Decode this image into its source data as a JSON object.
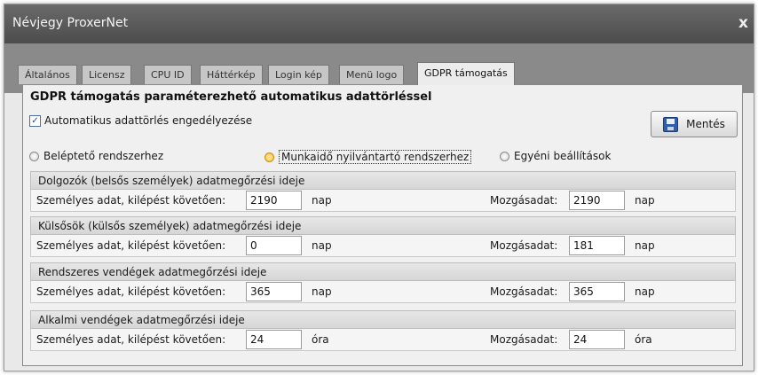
{
  "window": {
    "title": "Névjegy ProxerNet",
    "close_glyph": "x"
  },
  "tabs": [
    "Általános",
    "Licensz",
    "CPU ID",
    "Háttérkép",
    "Login kép",
    "Menü logo",
    "GDPR támogatás"
  ],
  "active_tab_index": 6,
  "panel": {
    "heading": "GDPR támogatás paraméterezhető automatikus adattörléssel",
    "auto_delete": {
      "label": "Automatikus adattörlés engedélyezése",
      "checked": true,
      "mark": "✓"
    },
    "save_label": "Mentés",
    "save_icon": "floppy-disk-icon",
    "modes": [
      {
        "label": "Beléptető rendszerhez",
        "selected": false
      },
      {
        "label": "Munkaidő nyilvántartó rendszerhez",
        "selected": true
      },
      {
        "label": "Egyéni beállítások",
        "selected": false
      }
    ],
    "sections": [
      {
        "title": "Dolgozók (belsős személyek) adatmegőrzési ideje",
        "personal_label": "Személyes adat, kilépést követően:",
        "personal_value": "2190",
        "personal_unit": "nap",
        "movement_label": "Mozgásadat:",
        "movement_value": "2190",
        "movement_unit": "nap"
      },
      {
        "title": "Külsősök (külsős személyek) adatmegőrzési ideje",
        "personal_label": "Személyes adat, kilépést követően:",
        "personal_value": "0",
        "personal_unit": "nap",
        "movement_label": "Mozgásadat:",
        "movement_value": "181",
        "movement_unit": "nap"
      },
      {
        "title": "Rendszeres vendégek adatmegőrzési ideje",
        "personal_label": "Személyes adat, kilépést követően:",
        "personal_value": "365",
        "personal_unit": "nap",
        "movement_label": "Mozgásadat:",
        "movement_value": "365",
        "movement_unit": "nap"
      },
      {
        "title": "Alkalmi vendégek adatmegőrzési ideje",
        "personal_label": "Személyes adat, kilépést követően:",
        "personal_value": "24",
        "personal_unit": "óra",
        "movement_label": "Mozgásadat:",
        "movement_value": "24",
        "movement_unit": "óra"
      }
    ]
  }
}
